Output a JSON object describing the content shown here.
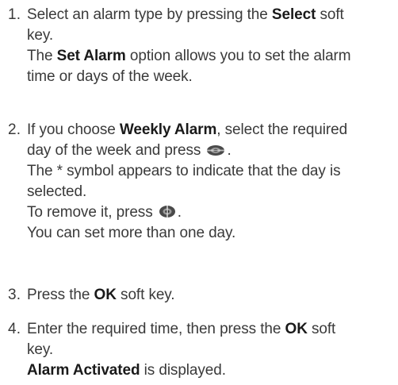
{
  "steps": [
    {
      "number": "1.",
      "line1_pre": "Select an alarm type by pressing the ",
      "line1_bold": "Select",
      "line1_post": " soft",
      "line2": "key.",
      "line3_pre": "The ",
      "line3_bold": "Set Alarm",
      "line3_post": " option allows you to set the alarm",
      "line4": "time or days of the week."
    },
    {
      "number": "2.",
      "line1_pre": "If you choose ",
      "line1_bold": "Weekly Alarm",
      "line1_post": ", select the required",
      "line2_pre": "day of the week and press ",
      "line2_post": ".",
      "line2_icon": "navigation-key-icon",
      "line3": "The * symbol appears to indicate that the day is",
      "line4": "selected.",
      "line5_pre": "To remove it, press ",
      "line5_post": ".",
      "line5_icon": "navigation-key-icon",
      "line6": "You can set more than one day."
    },
    {
      "number": "3.",
      "line1_pre": "Press the ",
      "line1_bold": "OK",
      "line1_post": " soft key."
    },
    {
      "number": "4.",
      "line1_pre": "Enter the required time, then press the ",
      "line1_bold": "OK",
      "line1_post": " soft",
      "line2": "key.",
      "line3_bold": "Alarm Activated",
      "line3_post": " is displayed."
    }
  ]
}
